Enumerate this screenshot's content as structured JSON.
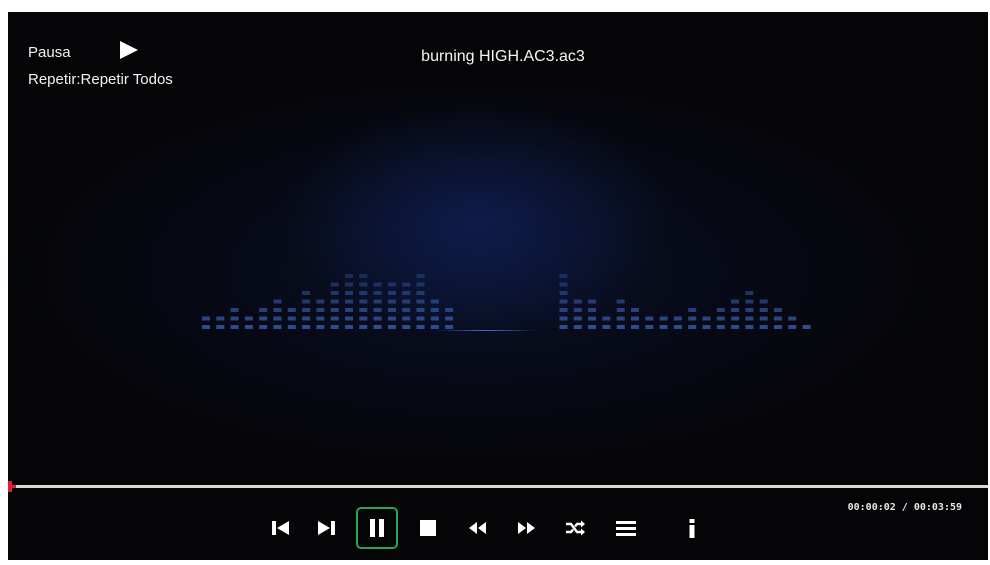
{
  "status": {
    "pause_label": "Pausa",
    "repeat_label": "Repetir:Repetir Todos"
  },
  "now_playing": {
    "title": "burning HIGH.AC3.ac3"
  },
  "playback": {
    "time_readout": "00:00:02 / 00:03:59",
    "progress_fraction": 0.008
  },
  "controls": [
    {
      "name": "previous-button",
      "icon": "skip-previous-icon"
    },
    {
      "name": "next-button",
      "icon": "skip-next-icon"
    },
    {
      "name": "pause-button",
      "icon": "pause-icon",
      "focused": true
    },
    {
      "name": "stop-button",
      "icon": "stop-icon"
    },
    {
      "name": "rewind-button",
      "icon": "rewind-icon"
    },
    {
      "name": "fast-forward-button",
      "icon": "fast-forward-icon"
    },
    {
      "name": "shuffle-button",
      "icon": "shuffle-icon"
    },
    {
      "name": "playlist-button",
      "icon": "playlist-icon"
    },
    {
      "name": "info-button",
      "icon": "info-icon"
    }
  ],
  "visualizer": {
    "band_levels": [
      2,
      2,
      3,
      2,
      3,
      4,
      3,
      5,
      4,
      6,
      7,
      7,
      6,
      6,
      6,
      7,
      4,
      3,
      0,
      0,
      0,
      0,
      0,
      0,
      0,
      7,
      4,
      4,
      2,
      4,
      3,
      2,
      2,
      2,
      3,
      2,
      3,
      4,
      5,
      4,
      3,
      2,
      1
    ]
  },
  "colors": {
    "accent": "#e01e3c",
    "focus_ring": "#27a35a",
    "eq_dot": "#3f60b8",
    "background": "#050508"
  }
}
